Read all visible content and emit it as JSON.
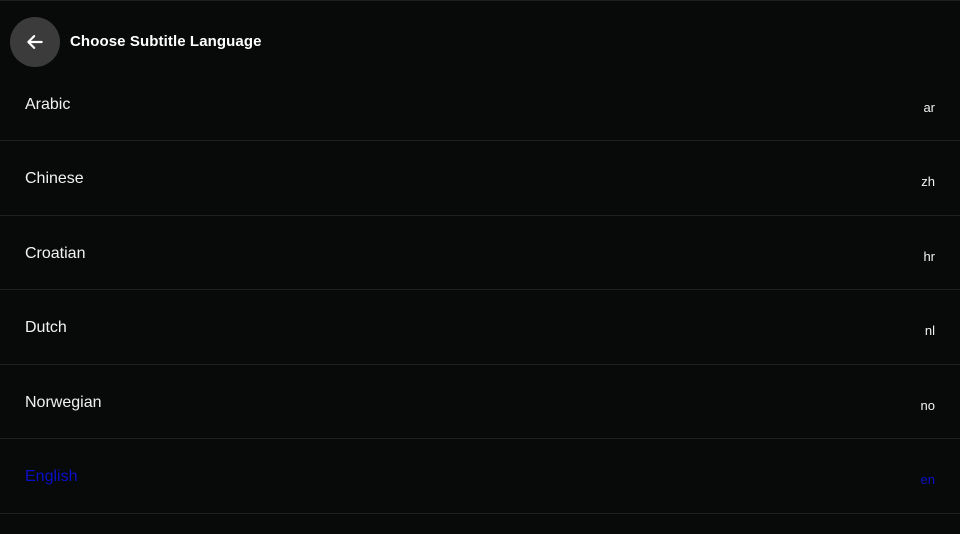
{
  "header": {
    "back_icon": "arrow-left-icon",
    "title": "Choose Subtitle Language"
  },
  "colors": {
    "background": "#080909",
    "text": "#f2f2f2",
    "selected_text": "#0a10c8",
    "back_button_bg": "#3b3b3b",
    "divider": "#1e2120"
  },
  "languages": [
    {
      "name": "Arabic",
      "code": "ar",
      "selected": false
    },
    {
      "name": "Chinese",
      "code": "zh",
      "selected": false
    },
    {
      "name": "Croatian",
      "code": "hr",
      "selected": false
    },
    {
      "name": "Dutch",
      "code": "nl",
      "selected": false
    },
    {
      "name": "Norwegian",
      "code": "no",
      "selected": false
    },
    {
      "name": "English",
      "code": "en",
      "selected": true
    }
  ]
}
